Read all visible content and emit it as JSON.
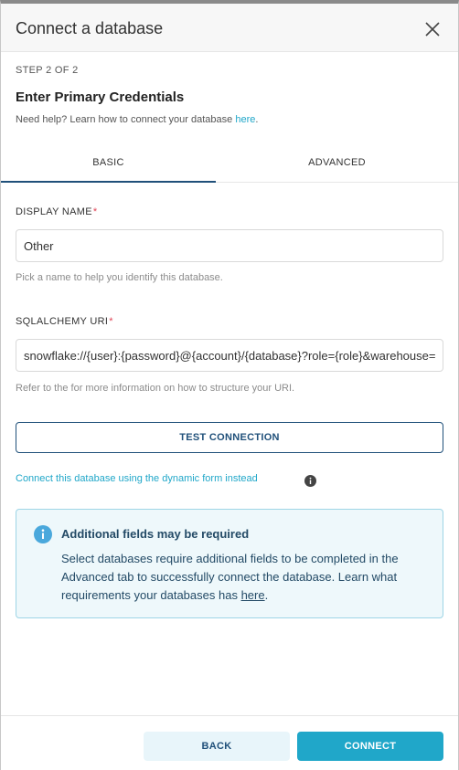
{
  "modal": {
    "title": "Connect a database",
    "step": "STEP 2 OF 2",
    "subtitle": "Enter Primary Credentials",
    "help_prefix": "Need help? Learn how to connect your database ",
    "help_link": "here",
    "help_suffix": "."
  },
  "tabs": [
    {
      "label": "BASIC",
      "active": true
    },
    {
      "label": "ADVANCED",
      "active": false
    }
  ],
  "display_name": {
    "label": "DISPLAY NAME",
    "required_mark": "*",
    "value": "Other",
    "hint": "Pick a name to help you identify this database."
  },
  "sqlalchemy": {
    "label": "SQLALCHEMY URI",
    "required_mark": "*",
    "value": "snowflake://{user}:{password}@{account}/{database}?role={role}&warehouse={warehouse}",
    "hint": "Refer to the for more information on how to structure your URI."
  },
  "test_connection": "TEST CONNECTION",
  "dynamic_form_link": "Connect this database using the dynamic form instead",
  "alert": {
    "title": "Additional fields may be required",
    "body": "Select databases require additional fields to be completed in the Advanced tab to successfully connect the database. Learn what requirements your databases has ",
    "link": "here",
    "suffix": "."
  },
  "footer": {
    "back": "BACK",
    "connect": "CONNECT"
  },
  "colors": {
    "primary": "#20a7c9",
    "dark": "#20507a",
    "required": "#e04355",
    "alert_bg": "#eef8fb"
  },
  "icons": {
    "close": "close-icon",
    "info": "info-icon"
  }
}
